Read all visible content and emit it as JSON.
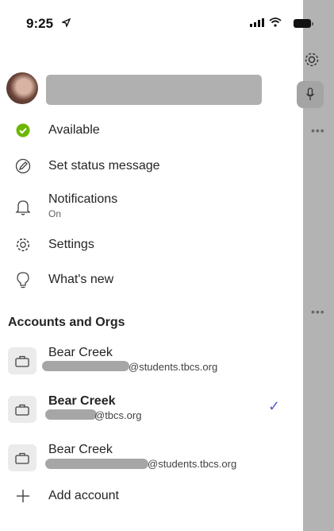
{
  "status_bar": {
    "time": "9:25"
  },
  "profile": {
    "name_redacted": true
  },
  "menu": [
    {
      "label": "Available",
      "icon": "available-check-icon"
    },
    {
      "label": "Set status message",
      "icon": "pencil-icon"
    },
    {
      "label": "Notifications",
      "sub": "On",
      "icon": "bell-icon"
    },
    {
      "label": "Settings",
      "icon": "gear-icon"
    },
    {
      "label": "What's new",
      "icon": "lightbulb-icon"
    }
  ],
  "accounts_header": "Accounts and Orgs",
  "accounts": [
    {
      "org": "Bear Creek",
      "email_domain": "@students.tbcs.org",
      "active": false
    },
    {
      "org": "Bear Creek",
      "email_domain": "@tbcs.org",
      "active": true
    },
    {
      "org": "Bear Creek",
      "email_domain": "@students.tbcs.org",
      "active": false
    }
  ],
  "add_account_label": "Add account",
  "colors": {
    "available": "#6bb700",
    "accent": "#5b5fc7",
    "pane": "#b3b3b3"
  }
}
